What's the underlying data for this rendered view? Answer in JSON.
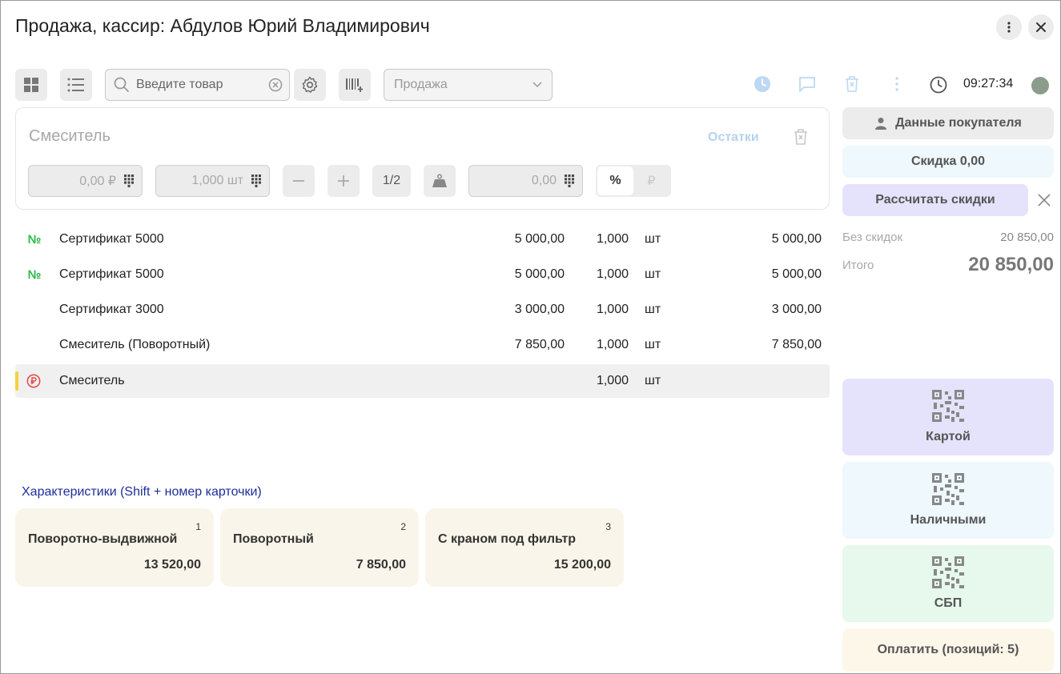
{
  "window": {
    "title": "Продажа, кассир: Абдулов Юрий Владимирович"
  },
  "toolbar": {
    "search_placeholder": "Введите товар",
    "operation_select": "Продажа",
    "time": "09:27:34"
  },
  "editor": {
    "item_name": "Смеситель",
    "stock_link": "Остатки",
    "price": "0,00 ₽",
    "quantity": "1,000 шт",
    "half_label": "1/2",
    "discount": "0,00",
    "percent_label": "%",
    "ruble_label": "₽"
  },
  "items": [
    {
      "badge": "№",
      "name": "Сертификат 5000",
      "price": "5 000,00",
      "qty": "1,000",
      "unit": "шт",
      "sum": "5 000,00"
    },
    {
      "badge": "№",
      "name": "Сертификат 5000",
      "price": "5 000,00",
      "qty": "1,000",
      "unit": "шт",
      "sum": "5 000,00"
    },
    {
      "badge": "",
      "name": "Сертификат 3000",
      "price": "3 000,00",
      "qty": "1,000",
      "unit": "шт",
      "sum": "3 000,00"
    },
    {
      "badge": "",
      "name": "Смеситель (Поворотный)",
      "price": "7 850,00",
      "qty": "1,000",
      "unit": "шт",
      "sum": "7 850,00"
    },
    {
      "badge": "",
      "name": "Смеситель",
      "price": "",
      "qty": "1,000",
      "unit": "шт",
      "sum": ""
    }
  ],
  "characteristics": {
    "title": "Характеристики (Shift + номер карточки)",
    "cards": [
      {
        "num": "1",
        "name": "Поворотно-выдвижной",
        "price": "13 520,00"
      },
      {
        "num": "2",
        "name": "Поворотный",
        "price": "7 850,00"
      },
      {
        "num": "3",
        "name": "С краном под фильтр",
        "price": "15 200,00"
      }
    ]
  },
  "right_panel": {
    "customer_button": "Данные покупателя",
    "discount_button": "Скидка 0,00",
    "calc_discounts_button": "Рассчитать скидки",
    "no_discount_label": "Без скидок",
    "no_discount_value": "20 850,00",
    "total_label": "Итого",
    "total_value": "20 850,00",
    "pay_card": "Картой",
    "pay_cash": "Наличными",
    "pay_sbp": "СБП",
    "pay_button": "Оплатить (позиций: 5)"
  },
  "colors": {
    "accent_green": "#2bb84a",
    "accent_red": "#e64545",
    "selection_marker": "#f2d23d",
    "card_bg": "#faf5ea",
    "pay_card_bg": "#e4e3fb",
    "pay_cash_bg": "#eef8fd",
    "pay_sbp_bg": "#e6f9ec"
  }
}
